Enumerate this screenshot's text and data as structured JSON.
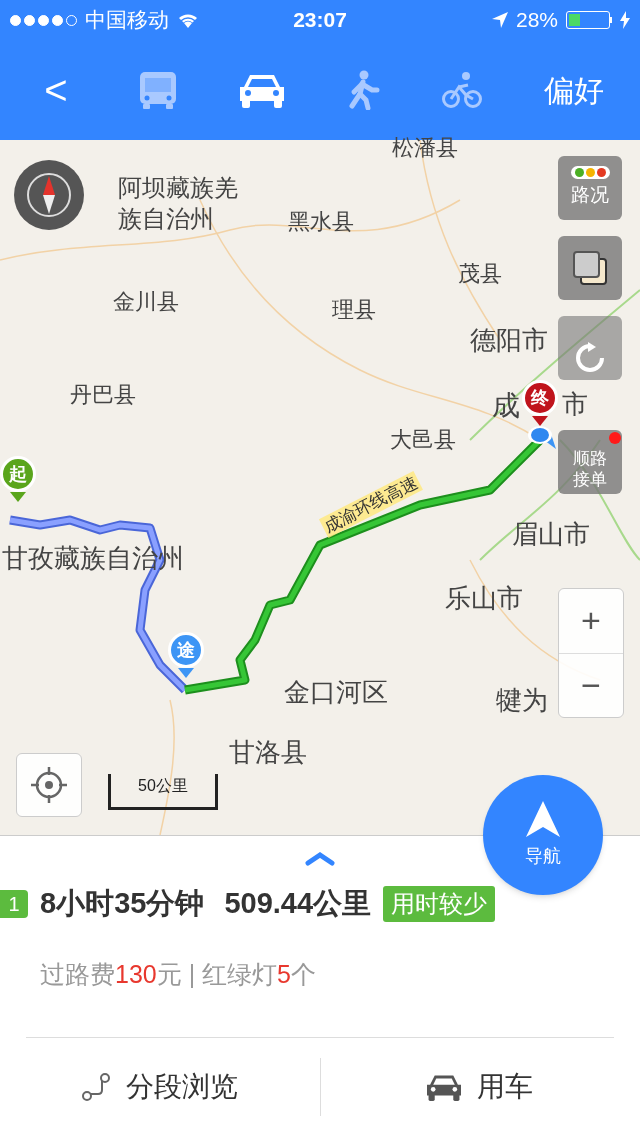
{
  "status_bar": {
    "carrier": "中国移动",
    "time": "23:07",
    "battery": "28%"
  },
  "nav": {
    "back": "<",
    "preference": "偏好",
    "modes": [
      {
        "kind": "bus",
        "selected": false
      },
      {
        "kind": "car",
        "selected": true
      },
      {
        "kind": "walk",
        "selected": false
      },
      {
        "kind": "bike",
        "selected": false
      }
    ]
  },
  "map": {
    "labels": [
      {
        "text": "松潘县"
      },
      {
        "text": "阿坝藏族羌族自治州"
      },
      {
        "text": "黑水县"
      },
      {
        "text": "茂县"
      },
      {
        "text": "金川县"
      },
      {
        "text": "理县"
      },
      {
        "text": "德阳市"
      },
      {
        "text": "丹巴县"
      },
      {
        "text": "成"
      },
      {
        "text": "市"
      },
      {
        "text": "大邑县"
      },
      {
        "text": "眉山市"
      },
      {
        "text": "乐山市"
      },
      {
        "text": "甘孜藏族自治州"
      },
      {
        "text": "金口河区"
      },
      {
        "text": "甘洛县"
      },
      {
        "text": "犍为"
      }
    ],
    "road_label": "成渝环线高速",
    "markers": {
      "start": "起",
      "via": "途",
      "end": "终"
    },
    "traffic_button": "路况",
    "ride_button": "顺路接单",
    "ride_badge": true,
    "zoom_in": "+",
    "zoom_out": "−",
    "scale": "50公里",
    "navigate_button": "导航"
  },
  "route": {
    "index": "1",
    "duration": "8小时35分钟",
    "distance": "509.44公里",
    "tag": "用时较少",
    "details": [
      {
        "text": "过路费",
        "highlight": false
      },
      {
        "text": "130",
        "highlight": true
      },
      {
        "text": "元 | 红绿灯",
        "highlight": false
      },
      {
        "text": "5",
        "highlight": true
      },
      {
        "text": "个",
        "highlight": false
      }
    ]
  },
  "actions": [
    {
      "kind": "segments",
      "label": "分段浏览"
    },
    {
      "kind": "car",
      "label": "用车"
    }
  ]
}
